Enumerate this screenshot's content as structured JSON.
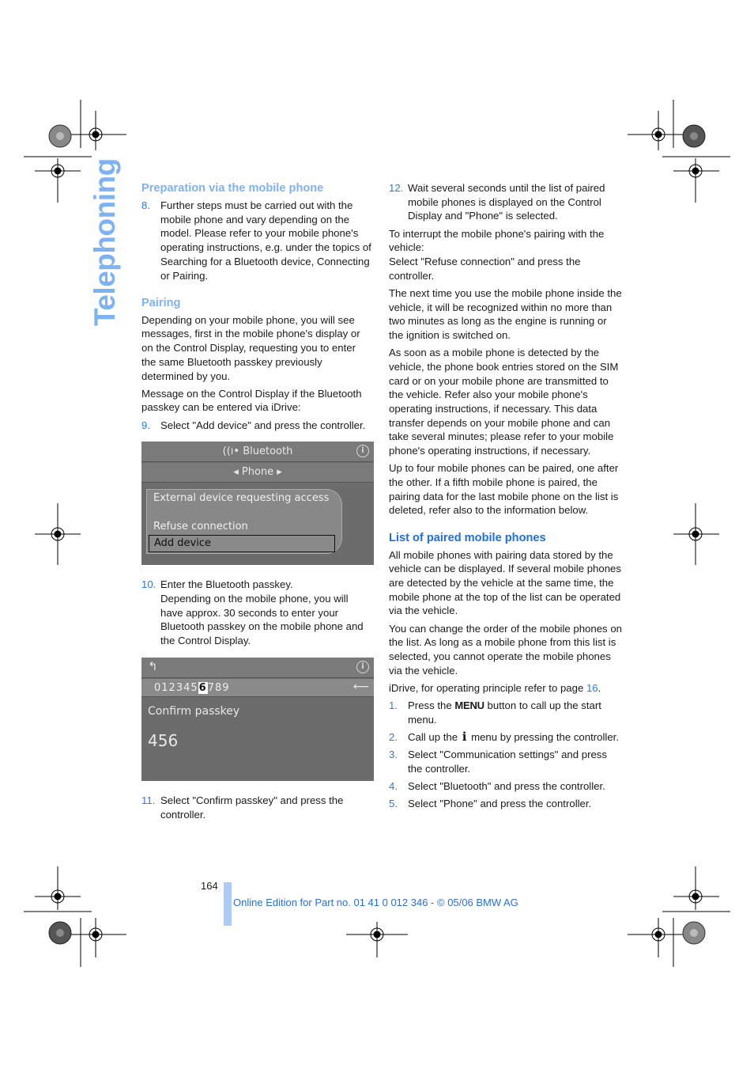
{
  "side_title": "Telephoning",
  "left_column": {
    "section1": {
      "heading": "Preparation via the mobile phone",
      "step8": {
        "num": "8.",
        "text": "Further steps must be carried out with the mobile phone and vary depending on the model. Please refer to your mobile phone's operating instructions, e.g. under the topics of Searching for a Bluetooth device, Connecting or Pairing."
      }
    },
    "section2": {
      "heading": "Pairing",
      "para1": "Depending on your mobile phone, you will see messages, first in the mobile phone's display or on the Control Display, requesting you to enter the same Bluetooth passkey previously determined by you.",
      "para2": "Message on the Control Display if the Bluetooth passkey can be entered via iDrive:",
      "step9": {
        "num": "9.",
        "text": "Select \"Add device\" and press the controller."
      },
      "screen1": {
        "title": "Bluetooth",
        "subtitle": "Phone",
        "popup_title": "External device requesting access",
        "option1": "Refuse connection",
        "option2": "Add device"
      },
      "step10": {
        "num": "10.",
        "text": "Enter the Bluetooth passkey.",
        "text2": "Depending on the mobile phone, you will have approx. 30 seconds to enter your Bluetooth passkey on the mobile phone and the Control Display."
      },
      "screen2": {
        "digits_before": "012345",
        "digit_selected": "6",
        "digits_after": "789",
        "label": "Confirm passkey",
        "value": "456"
      },
      "step11": {
        "num": "11.",
        "text": "Select \"Confirm passkey\" and press the controller."
      }
    }
  },
  "right_column": {
    "step12": {
      "num": "12.",
      "text": "Wait several seconds until the list of paired mobile phones is displayed on the Control Display and \"Phone\" is selected."
    },
    "para1": "To interrupt the mobile phone's pairing with the vehicle:",
    "para1b": "Select \"Refuse connection\" and press the controller.",
    "para2": "The next time you use the mobile phone inside the vehicle, it will be recognized within no more than two minutes as long as the engine is running or the ignition is switched on.",
    "para3": "As soon as a mobile phone is detected by the vehicle, the phone book entries stored on the SIM card or on your mobile phone are transmitted to the vehicle. Refer also your mobile phone's operating instructions, if necessary. This data transfer depends on your mobile phone and can take several minutes; please refer to your mobile phone's operating instructions, if necessary.",
    "para4": "Up to four mobile phones can be paired, one after the other. If a fifth mobile phone is paired, the pairing data for the last mobile phone on the list is deleted, refer also to the information below.",
    "section_heading": "List of paired mobile phones",
    "para5": "All mobile phones with pairing data stored by the vehicle can be displayed. If several mobile phones are detected by the vehicle at the same time, the mobile phone at the top of the list can be operated via the vehicle.",
    "para6": "You can change the order of the mobile phones on the list. As long as a mobile phone from this list is selected, you cannot operate the mobile phones via the vehicle.",
    "para7_prefix": "iDrive, for operating principle refer to page ",
    "para7_link": "16",
    "para7_suffix": ".",
    "steps": [
      {
        "num": "1.",
        "pre": "Press the ",
        "bold": "MENU",
        "post": " button to call up the start menu."
      },
      {
        "num": "2.",
        "pre": "Call up the ",
        "icon": "i",
        "post": " menu by pressing the controller."
      },
      {
        "num": "3.",
        "text": "Select \"Communication settings\" and press the controller."
      },
      {
        "num": "4.",
        "text": "Select \"Bluetooth\" and press the controller."
      },
      {
        "num": "5.",
        "text": "Select \"Phone\" and press the controller."
      }
    ]
  },
  "footer": {
    "page_number": "164",
    "edition": "Online Edition for Part no. 01 41 0 012 346 - © 05/06 BMW AG"
  }
}
